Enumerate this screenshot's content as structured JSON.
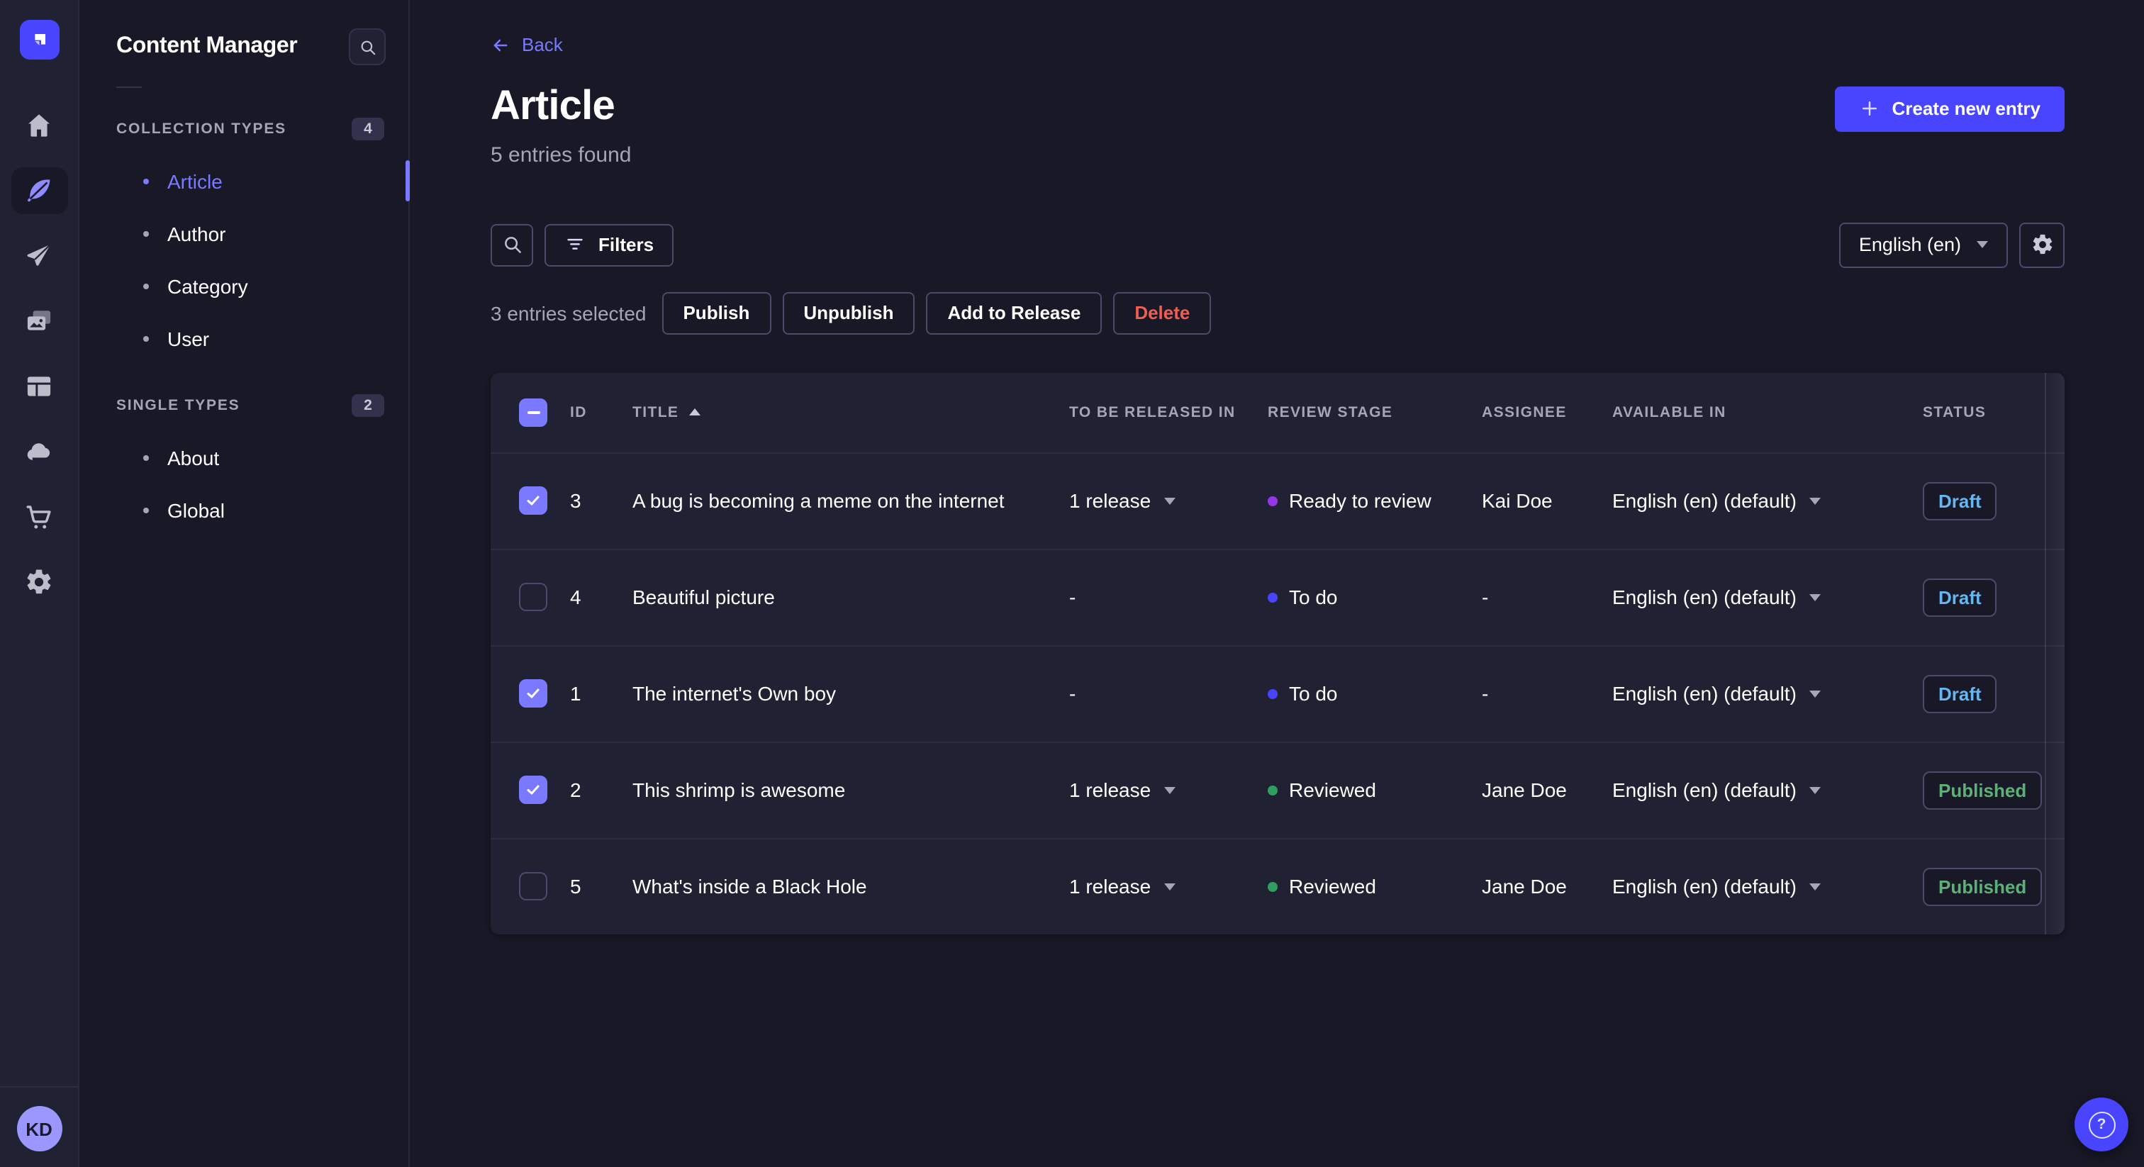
{
  "colors": {
    "accent": "#4945ff",
    "link": "#7b79ff",
    "checkbox_checked": "#7b79ff",
    "status_draft": "#66b7f1",
    "status_published": "#5cb176",
    "danger": "#ee5e52",
    "stage_to_do": "#4945ff",
    "stage_ready_to_review": "#9736e8",
    "stage_reviewed": "#2f9e5f"
  },
  "rail": {
    "items": [
      {
        "icon": "home"
      },
      {
        "icon": "content-manager",
        "active": true
      },
      {
        "icon": "releases"
      },
      {
        "icon": "media-library"
      },
      {
        "icon": "content-type-builder"
      },
      {
        "icon": "cloud"
      },
      {
        "icon": "marketplace"
      },
      {
        "icon": "settings"
      }
    ]
  },
  "user": {
    "initials": "KD"
  },
  "sidebar": {
    "title": "Content Manager",
    "sections": [
      {
        "label": "COLLECTION TYPES",
        "count": "4",
        "items": [
          {
            "label": "Article",
            "active": true
          },
          {
            "label": "Author"
          },
          {
            "label": "Category"
          },
          {
            "label": "User"
          }
        ]
      },
      {
        "label": "SINGLE TYPES",
        "count": "2",
        "items": [
          {
            "label": "About"
          },
          {
            "label": "Global"
          }
        ]
      }
    ]
  },
  "header": {
    "back_label": "Back",
    "title": "Article",
    "subtitle": "5 entries found",
    "create_button_label": "Create new entry"
  },
  "toolbar": {
    "filters_label": "Filters",
    "locale_value": "English (en)"
  },
  "selection": {
    "text": "3 entries selected",
    "actions": [
      {
        "label": "Publish"
      },
      {
        "label": "Unpublish"
      },
      {
        "label": "Add to Release"
      },
      {
        "label": "Delete",
        "danger": true
      }
    ]
  },
  "table": {
    "columns": [
      "ID",
      "TITLE",
      "TO BE RELEASED IN",
      "REVIEW STAGE",
      "ASSIGNEE",
      "AVAILABLE IN",
      "STATUS"
    ],
    "sort": {
      "column": "TITLE",
      "direction": "ascending"
    },
    "rows": [
      {
        "checked": true,
        "id": "3",
        "title": "A bug is becoming a meme on the internet",
        "release": "1 release",
        "release_caret": true,
        "review_stage": "Ready to review",
        "review_color": "#9736e8",
        "assignee": "Kai Doe",
        "locale": "English (en) (default)",
        "status": "Draft",
        "status_color": "#66b7f1"
      },
      {
        "checked": false,
        "id": "4",
        "title": "Beautiful picture",
        "release": "-",
        "release_caret": false,
        "review_stage": "To do",
        "review_color": "#4945ff",
        "assignee": "-",
        "locale": "English (en) (default)",
        "status": "Draft",
        "status_color": "#66b7f1"
      },
      {
        "checked": true,
        "id": "1",
        "title": "The internet's Own boy",
        "release": "-",
        "release_caret": false,
        "review_stage": "To do",
        "review_color": "#4945ff",
        "assignee": "-",
        "locale": "English (en) (default)",
        "status": "Draft",
        "status_color": "#66b7f1"
      },
      {
        "checked": true,
        "id": "2",
        "title": "This shrimp is awesome",
        "release": "1 release",
        "release_caret": true,
        "review_stage": "Reviewed",
        "review_color": "#2f9e5f",
        "assignee": "Jane Doe",
        "locale": "English (en) (default)",
        "status": "Published",
        "status_color": "#5cb176"
      },
      {
        "checked": false,
        "id": "5",
        "title": "What's inside a Black Hole",
        "release": "1 release",
        "release_caret": true,
        "review_stage": "Reviewed",
        "review_color": "#2f9e5f",
        "assignee": "Jane Doe",
        "locale": "English (en) (default)",
        "status": "Published",
        "status_color": "#5cb176"
      }
    ]
  },
  "help": {
    "icon": "question-mark"
  }
}
